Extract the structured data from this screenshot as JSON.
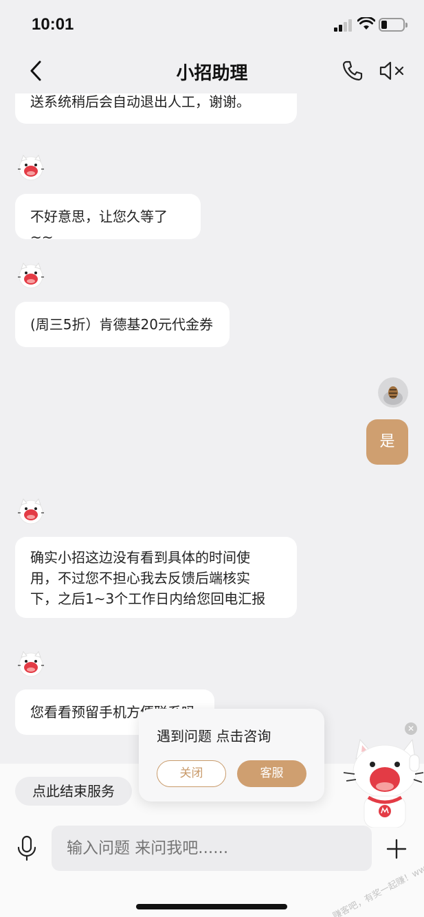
{
  "status_bar": {
    "time": "10:01"
  },
  "nav": {
    "title": "小招助理"
  },
  "messages": [
    {
      "from": "bot",
      "text": "送系统稍后会自动退出人工，谢谢。"
    },
    {
      "from": "bot",
      "text": "不好意思，让您久等了~~"
    },
    {
      "from": "bot",
      "text": "(周三5折）肯德基20元代金券"
    },
    {
      "from": "user",
      "text": "是"
    },
    {
      "from": "bot",
      "lines": [
        "确实小招这边没有看到具体的时间使",
        "用，不过您不担心我去反馈后端核实",
        "下，之后1~3个工作日内给您回电汇报"
      ]
    },
    {
      "from": "bot",
      "text": "您看看预留手机方便联系吗"
    }
  ],
  "bottom": {
    "end_service_label": "点此结束服务",
    "input_placeholder": "输入问题 来问我吧......"
  },
  "popup": {
    "text": "遇到问题 点击咨询",
    "close_label": "关闭",
    "service_label": "客服"
  },
  "watermark": "赚客吧，有奖一起赚！www.zuanke8.com",
  "colors": {
    "accent": "#cf9f70",
    "background": "#f0f0f2"
  }
}
